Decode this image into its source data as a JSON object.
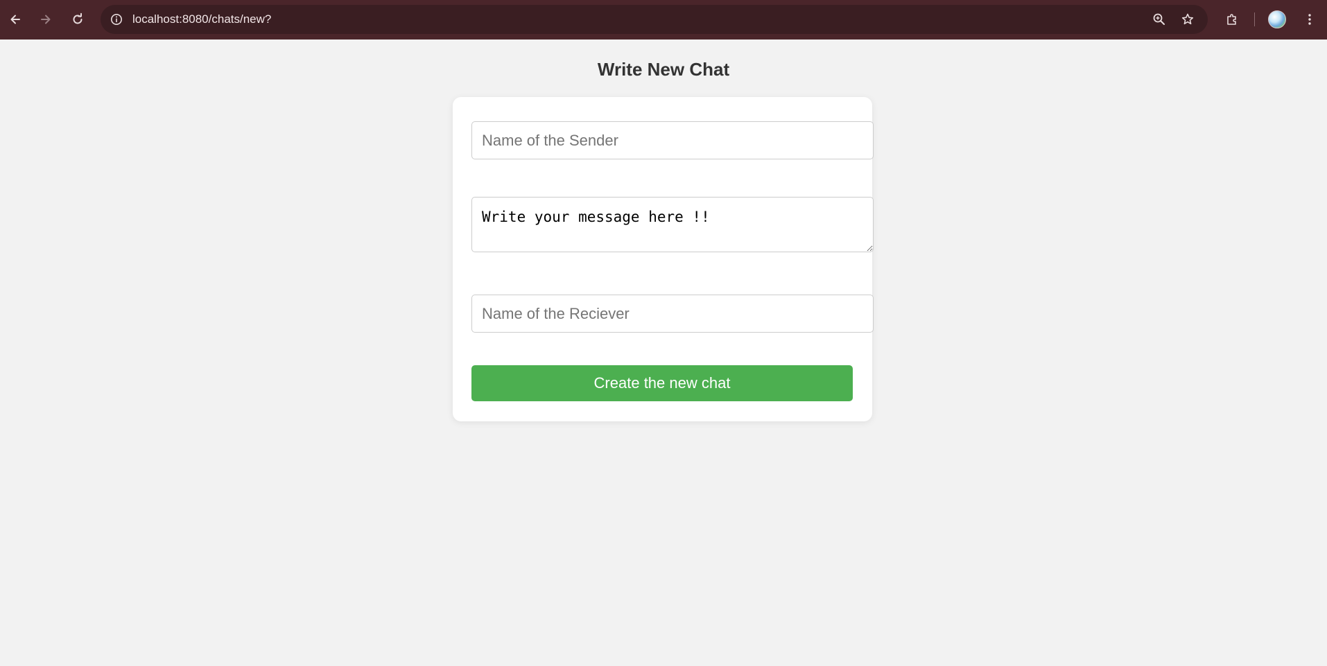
{
  "browser": {
    "url": "localhost:8080/chats/new?",
    "icons": [
      "back-arrow-icon",
      "forward-arrow-icon",
      "reload-icon",
      "site-info-icon",
      "zoom-icon",
      "bookmark-star-icon",
      "extensions-icon",
      "profile-avatar",
      "more-menu-icon"
    ],
    "colors": {
      "toolbar": "#4a252a",
      "omnibox": "#3a1e22"
    }
  },
  "page": {
    "title": "Write New Chat",
    "background": "#f2f2f2"
  },
  "form": {
    "sender": {
      "placeholder": "Name of the Sender",
      "value": ""
    },
    "message": {
      "placeholder": "",
      "value": "Write your message here !!"
    },
    "receiver": {
      "placeholder": "Name of the Reciever",
      "value": ""
    },
    "submit_label": "Create the new chat",
    "submit_color": "#4caf50"
  }
}
